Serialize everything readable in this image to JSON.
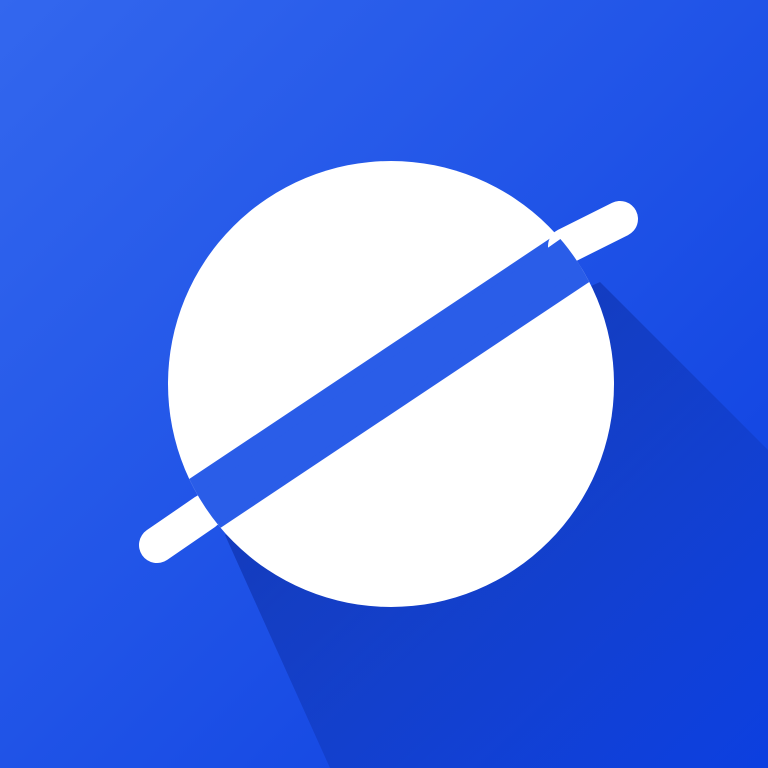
{
  "icon": {
    "name": "planet-logo-icon",
    "colors": {
      "background_start": "#3367ee",
      "background_end": "#0c3fe0",
      "shadow": "#0a2a9e",
      "planet": "#ffffff",
      "ring": "#ffffff",
      "ring_gap": "#2a5de8"
    }
  }
}
